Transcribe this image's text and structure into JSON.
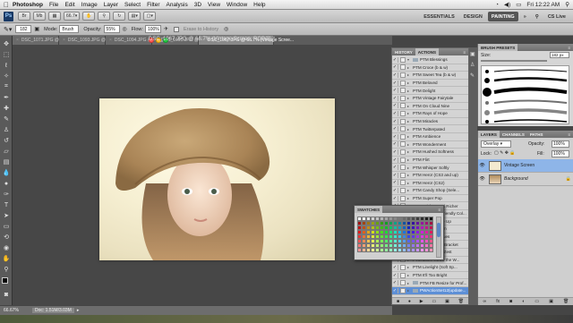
{
  "menubar": {
    "apple": "",
    "items": [
      "Photoshop",
      "File",
      "Edit",
      "Image",
      "Layer",
      "Select",
      "Filter",
      "Analysis",
      "3D",
      "View",
      "Window",
      "Help"
    ],
    "clock": "Fri 12:22 AM"
  },
  "appbar": {
    "logo": "Ps",
    "zoom": "66.7",
    "workspaces": [
      "ESSENTIALS",
      "DESIGN",
      "PAINTING"
    ],
    "cs_live": "CS Live"
  },
  "options": {
    "brush_size": "182",
    "mode_label": "Mode:",
    "mode_value": "Brush",
    "opacity_label": "Opacity:",
    "opacity_value": "55%",
    "flow_label": "Flow:",
    "flow_value": "100%",
    "erase_history": "Erase to History"
  },
  "tabs": [
    "DSC_1071.JPG @ 25% (RG...",
    "DSC_1093.JPG @ 25% (RG...",
    "DSC_1094.JPG @ 25% (RG...",
    "DSC_1095.JPG @ 25% (RG...",
    "DSC_1067.JPG @ 66.7% (Vintage Scree..."
  ],
  "doc_title": "DSC_1067.JPG @ 66.7% (Vintage Screen, RGB/8) *",
  "status": {
    "zoom": "66.67%",
    "doc": "Doc: 1.51M/3.03M"
  },
  "actions_panel": {
    "tabs": [
      "HISTORY",
      "ACTIONS"
    ],
    "items": [
      "PTM Blessings",
      "PTM Croce (b & w)",
      "PTM Sweet Tea (b & w)",
      "PTM Beloved",
      "PTM Delight",
      "PTM Vintage Fairytale",
      "PTM On Cloud Nine",
      "PTM Rays of Hope",
      "PTM Miracles",
      "PTM Twitterpated",
      "PTM Ambience",
      "PTM Wonderment",
      "PTM Hushed Softness",
      "PTM Flirt",
      "PTM Whisper Softly",
      "PTM Hero! (CS3 and up)",
      "PTM Hero! (CS2)",
      "PTM Candy Shop (Sele...",
      "PTM Super Pop",
      "PTM Brighter and Richer",
      "PTM Splash of Friendly Col...",
      "PTM Brighten Me Up",
      "PTM Tone It Down",
      "PTM Diminish Blues",
      "PTM Stick Them Bracket",
      "PTM Cool Them Zest",
      "PTM Don't Throw the W...",
      "PTM Linelight (Soft Sp...",
      "PTM It'll Too Bright",
      "PTM FB Resize for Prof...",
      "PWActionSet12(update..."
    ]
  },
  "swatches": {
    "title": "SWATCHES"
  },
  "brush_presets": {
    "title": "BRUSH PRESETS",
    "size_label": "Size:",
    "size_value": "182 px"
  },
  "layers": {
    "tabs": [
      "LAYERS",
      "CHANNELS",
      "PATHS"
    ],
    "blend_mode": "Overlay",
    "opacity_label": "Opacity:",
    "opacity_value": "100%",
    "lock_label": "Lock:",
    "fill_label": "Fill:",
    "fill_value": "100%",
    "items": [
      {
        "name": "Vintage Screen"
      },
      {
        "name": "Background"
      }
    ]
  },
  "colors": {
    "photo_bg": "#f2ebcc",
    "selection_blue": "#5d8fd6"
  }
}
